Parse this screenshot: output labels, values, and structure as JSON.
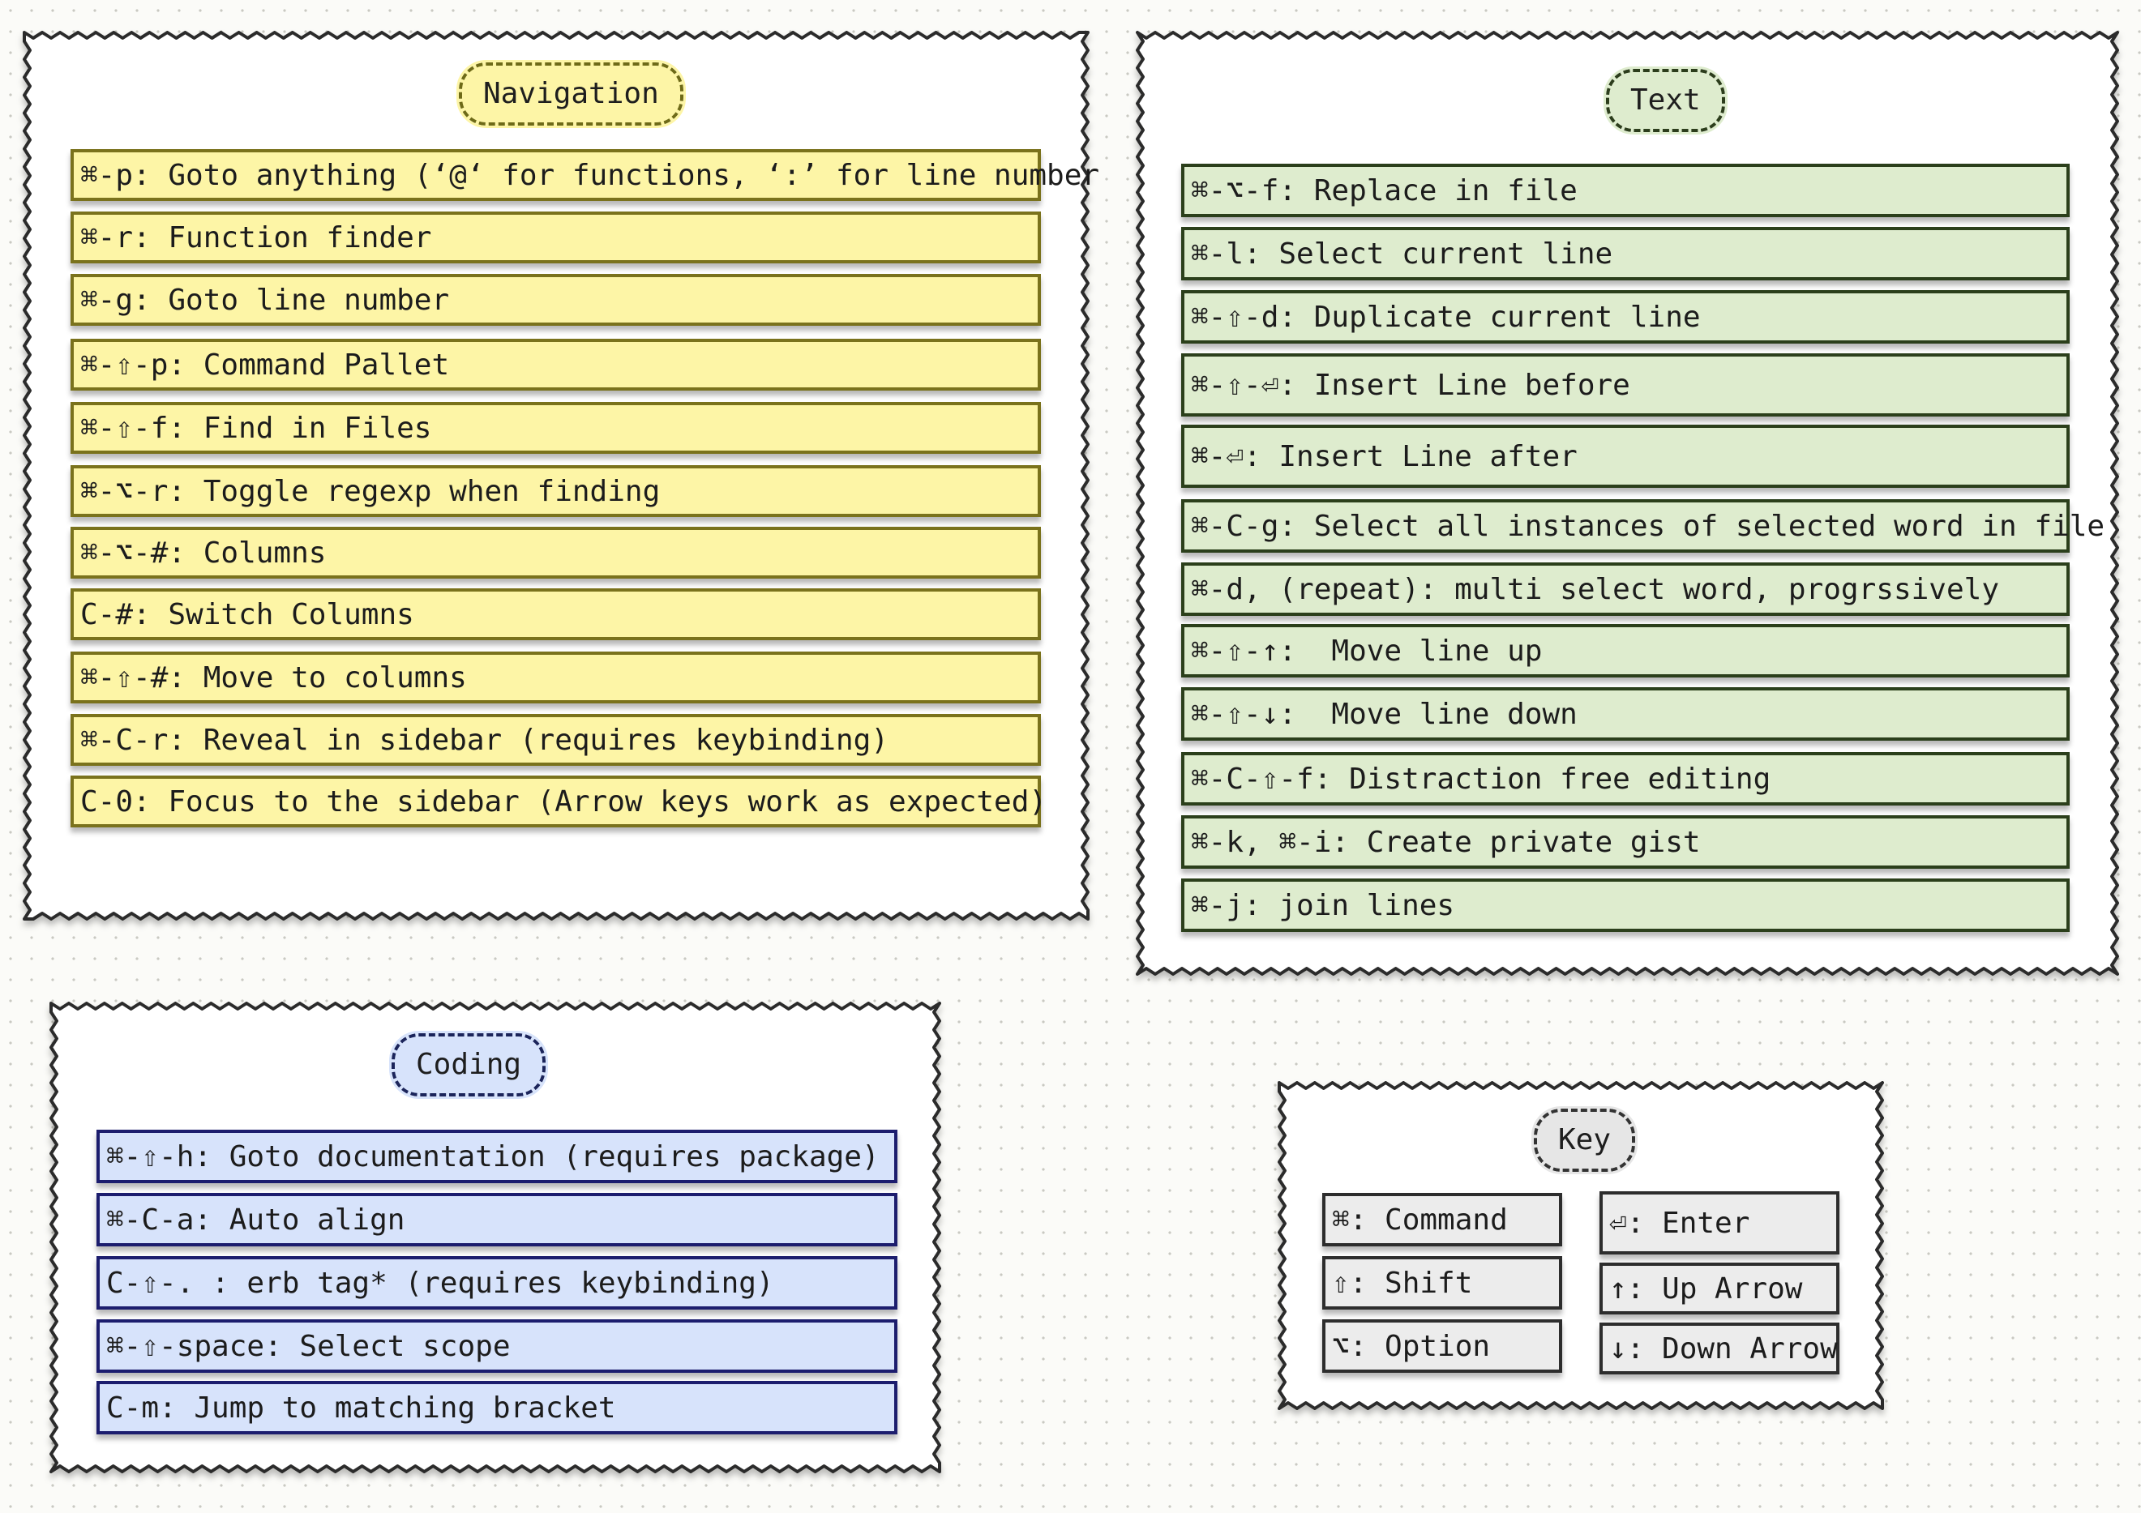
{
  "navigation": {
    "title": "Navigation",
    "items": [
      "⌘-p: Goto anything (‘@‘ for functions, ‘:’ for line number",
      "⌘-r: Function finder",
      "⌘-g: Goto line number",
      "⌘-⇧-p: Command Pallet",
      "⌘-⇧-f: Find in Files",
      "⌘-⌥-r: Toggle regexp when finding",
      "⌘-⌥-#: Columns",
      "C-#: Switch Columns",
      "⌘-⇧-#: Move to columns",
      "⌘-C-r: Reveal in sidebar (requires keybinding)",
      "C-0: Focus to the sidebar (Arrow keys work as expected)"
    ]
  },
  "text": {
    "title": "Text",
    "items": [
      "⌘-⌥-f: Replace in file",
      "⌘-l: Select current line",
      "⌘-⇧-d: Duplicate current line",
      "⌘-⇧-⏎: Insert Line before",
      "⌘-⏎: Insert Line after",
      "⌘-C-g: Select all instances of selected word in file",
      "⌘-d, (repeat): multi select word, progrssively",
      "⌘-⇧-↑:  Move line up",
      "⌘-⇧-↓:  Move line down",
      "⌘-C-⇧-f: Distraction free editing",
      "⌘-k, ⌘-i: Create private gist",
      "⌘-j: join lines"
    ]
  },
  "coding": {
    "title": "Coding",
    "items": [
      "⌘-⇧-h: Goto documentation (requires package)",
      "⌘-C-a: Auto align",
      "C-⇧-. : erb tag* (requires keybinding)",
      "⌘-⇧-space: Select scope",
      "C-m: Jump to matching bracket"
    ]
  },
  "key": {
    "title": "Key",
    "items": [
      "⌘: Command",
      "⇧: Shift",
      "⌥: Option",
      "⏎: Enter",
      "↑: Up Arrow",
      "↓: Down Arrow"
    ]
  }
}
